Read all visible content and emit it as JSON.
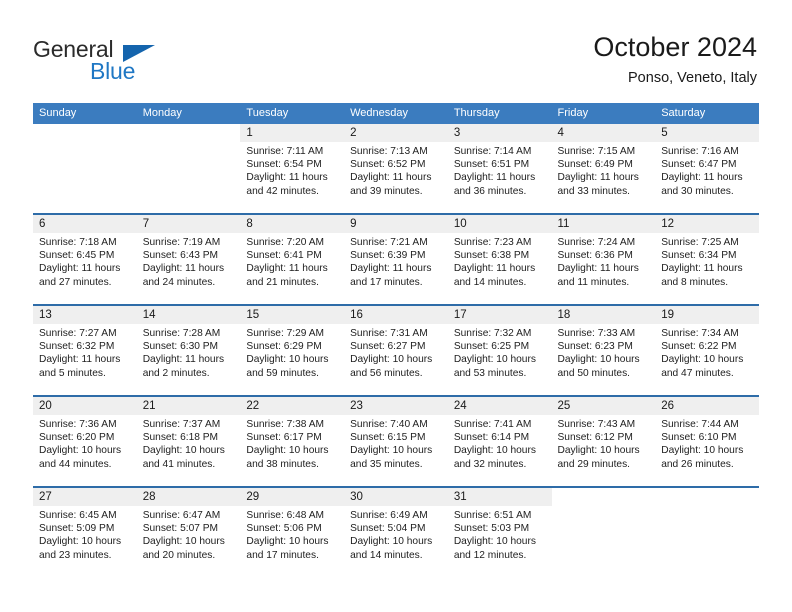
{
  "logo": {
    "text_primary": "General",
    "text_secondary": "Blue",
    "triangle_icon": "blue-triangle-icon",
    "color_primary": "#2b2b2b",
    "color_secondary": "#1f77c4",
    "color_triangle": "#1464ad"
  },
  "header": {
    "title": "October 2024",
    "subtitle": "Ponso, Veneto, Italy"
  },
  "colors": {
    "header_row_bg": "#3b7cbf",
    "week_separator": "#2e6ca8",
    "daynum_band_bg": "#efefef",
    "cell_bg": "#ffffff",
    "text": "#1e1e1e"
  },
  "weekdays": [
    {
      "label": "Sunday"
    },
    {
      "label": "Monday"
    },
    {
      "label": "Tuesday"
    },
    {
      "label": "Wednesday"
    },
    {
      "label": "Thursday"
    },
    {
      "label": "Friday"
    },
    {
      "label": "Saturday"
    }
  ],
  "labels": {
    "sunrise_prefix": "Sunrise:",
    "sunset_prefix": "Sunset:",
    "daylight_prefix": "Daylight:"
  },
  "weeks": [
    {
      "days": [
        {
          "empty": true,
          "daynum": "",
          "sunrise": "",
          "sunset": "",
          "daylight_line1": "",
          "daylight_line2": ""
        },
        {
          "empty": true,
          "daynum": "",
          "sunrise": "",
          "sunset": "",
          "daylight_line1": "",
          "daylight_line2": ""
        },
        {
          "empty": false,
          "daynum": "1",
          "sunrise": "Sunrise: 7:11 AM",
          "sunset": "Sunset: 6:54 PM",
          "daylight_line1": "Daylight: 11 hours",
          "daylight_line2": "and 42 minutes."
        },
        {
          "empty": false,
          "daynum": "2",
          "sunrise": "Sunrise: 7:13 AM",
          "sunset": "Sunset: 6:52 PM",
          "daylight_line1": "Daylight: 11 hours",
          "daylight_line2": "and 39 minutes."
        },
        {
          "empty": false,
          "daynum": "3",
          "sunrise": "Sunrise: 7:14 AM",
          "sunset": "Sunset: 6:51 PM",
          "daylight_line1": "Daylight: 11 hours",
          "daylight_line2": "and 36 minutes."
        },
        {
          "empty": false,
          "daynum": "4",
          "sunrise": "Sunrise: 7:15 AM",
          "sunset": "Sunset: 6:49 PM",
          "daylight_line1": "Daylight: 11 hours",
          "daylight_line2": "and 33 minutes."
        },
        {
          "empty": false,
          "daynum": "5",
          "sunrise": "Sunrise: 7:16 AM",
          "sunset": "Sunset: 6:47 PM",
          "daylight_line1": "Daylight: 11 hours",
          "daylight_line2": "and 30 minutes."
        }
      ]
    },
    {
      "days": [
        {
          "empty": false,
          "daynum": "6",
          "sunrise": "Sunrise: 7:18 AM",
          "sunset": "Sunset: 6:45 PM",
          "daylight_line1": "Daylight: 11 hours",
          "daylight_line2": "and 27 minutes."
        },
        {
          "empty": false,
          "daynum": "7",
          "sunrise": "Sunrise: 7:19 AM",
          "sunset": "Sunset: 6:43 PM",
          "daylight_line1": "Daylight: 11 hours",
          "daylight_line2": "and 24 minutes."
        },
        {
          "empty": false,
          "daynum": "8",
          "sunrise": "Sunrise: 7:20 AM",
          "sunset": "Sunset: 6:41 PM",
          "daylight_line1": "Daylight: 11 hours",
          "daylight_line2": "and 21 minutes."
        },
        {
          "empty": false,
          "daynum": "9",
          "sunrise": "Sunrise: 7:21 AM",
          "sunset": "Sunset: 6:39 PM",
          "daylight_line1": "Daylight: 11 hours",
          "daylight_line2": "and 17 minutes."
        },
        {
          "empty": false,
          "daynum": "10",
          "sunrise": "Sunrise: 7:23 AM",
          "sunset": "Sunset: 6:38 PM",
          "daylight_line1": "Daylight: 11 hours",
          "daylight_line2": "and 14 minutes."
        },
        {
          "empty": false,
          "daynum": "11",
          "sunrise": "Sunrise: 7:24 AM",
          "sunset": "Sunset: 6:36 PM",
          "daylight_line1": "Daylight: 11 hours",
          "daylight_line2": "and 11 minutes."
        },
        {
          "empty": false,
          "daynum": "12",
          "sunrise": "Sunrise: 7:25 AM",
          "sunset": "Sunset: 6:34 PM",
          "daylight_line1": "Daylight: 11 hours",
          "daylight_line2": "and 8 minutes."
        }
      ]
    },
    {
      "days": [
        {
          "empty": false,
          "daynum": "13",
          "sunrise": "Sunrise: 7:27 AM",
          "sunset": "Sunset: 6:32 PM",
          "daylight_line1": "Daylight: 11 hours",
          "daylight_line2": "and 5 minutes."
        },
        {
          "empty": false,
          "daynum": "14",
          "sunrise": "Sunrise: 7:28 AM",
          "sunset": "Sunset: 6:30 PM",
          "daylight_line1": "Daylight: 11 hours",
          "daylight_line2": "and 2 minutes."
        },
        {
          "empty": false,
          "daynum": "15",
          "sunrise": "Sunrise: 7:29 AM",
          "sunset": "Sunset: 6:29 PM",
          "daylight_line1": "Daylight: 10 hours",
          "daylight_line2": "and 59 minutes."
        },
        {
          "empty": false,
          "daynum": "16",
          "sunrise": "Sunrise: 7:31 AM",
          "sunset": "Sunset: 6:27 PM",
          "daylight_line1": "Daylight: 10 hours",
          "daylight_line2": "and 56 minutes."
        },
        {
          "empty": false,
          "daynum": "17",
          "sunrise": "Sunrise: 7:32 AM",
          "sunset": "Sunset: 6:25 PM",
          "daylight_line1": "Daylight: 10 hours",
          "daylight_line2": "and 53 minutes."
        },
        {
          "empty": false,
          "daynum": "18",
          "sunrise": "Sunrise: 7:33 AM",
          "sunset": "Sunset: 6:23 PM",
          "daylight_line1": "Daylight: 10 hours",
          "daylight_line2": "and 50 minutes."
        },
        {
          "empty": false,
          "daynum": "19",
          "sunrise": "Sunrise: 7:34 AM",
          "sunset": "Sunset: 6:22 PM",
          "daylight_line1": "Daylight: 10 hours",
          "daylight_line2": "and 47 minutes."
        }
      ]
    },
    {
      "days": [
        {
          "empty": false,
          "daynum": "20",
          "sunrise": "Sunrise: 7:36 AM",
          "sunset": "Sunset: 6:20 PM",
          "daylight_line1": "Daylight: 10 hours",
          "daylight_line2": "and 44 minutes."
        },
        {
          "empty": false,
          "daynum": "21",
          "sunrise": "Sunrise: 7:37 AM",
          "sunset": "Sunset: 6:18 PM",
          "daylight_line1": "Daylight: 10 hours",
          "daylight_line2": "and 41 minutes."
        },
        {
          "empty": false,
          "daynum": "22",
          "sunrise": "Sunrise: 7:38 AM",
          "sunset": "Sunset: 6:17 PM",
          "daylight_line1": "Daylight: 10 hours",
          "daylight_line2": "and 38 minutes."
        },
        {
          "empty": false,
          "daynum": "23",
          "sunrise": "Sunrise: 7:40 AM",
          "sunset": "Sunset: 6:15 PM",
          "daylight_line1": "Daylight: 10 hours",
          "daylight_line2": "and 35 minutes."
        },
        {
          "empty": false,
          "daynum": "24",
          "sunrise": "Sunrise: 7:41 AM",
          "sunset": "Sunset: 6:14 PM",
          "daylight_line1": "Daylight: 10 hours",
          "daylight_line2": "and 32 minutes."
        },
        {
          "empty": false,
          "daynum": "25",
          "sunrise": "Sunrise: 7:43 AM",
          "sunset": "Sunset: 6:12 PM",
          "daylight_line1": "Daylight: 10 hours",
          "daylight_line2": "and 29 minutes."
        },
        {
          "empty": false,
          "daynum": "26",
          "sunrise": "Sunrise: 7:44 AM",
          "sunset": "Sunset: 6:10 PM",
          "daylight_line1": "Daylight: 10 hours",
          "daylight_line2": "and 26 minutes."
        }
      ]
    },
    {
      "days": [
        {
          "empty": false,
          "daynum": "27",
          "sunrise": "Sunrise: 6:45 AM",
          "sunset": "Sunset: 5:09 PM",
          "daylight_line1": "Daylight: 10 hours",
          "daylight_line2": "and 23 minutes."
        },
        {
          "empty": false,
          "daynum": "28",
          "sunrise": "Sunrise: 6:47 AM",
          "sunset": "Sunset: 5:07 PM",
          "daylight_line1": "Daylight: 10 hours",
          "daylight_line2": "and 20 minutes."
        },
        {
          "empty": false,
          "daynum": "29",
          "sunrise": "Sunrise: 6:48 AM",
          "sunset": "Sunset: 5:06 PM",
          "daylight_line1": "Daylight: 10 hours",
          "daylight_line2": "and 17 minutes."
        },
        {
          "empty": false,
          "daynum": "30",
          "sunrise": "Sunrise: 6:49 AM",
          "sunset": "Sunset: 5:04 PM",
          "daylight_line1": "Daylight: 10 hours",
          "daylight_line2": "and 14 minutes."
        },
        {
          "empty": false,
          "daynum": "31",
          "sunrise": "Sunrise: 6:51 AM",
          "sunset": "Sunset: 5:03 PM",
          "daylight_line1": "Daylight: 10 hours",
          "daylight_line2": "and 12 minutes."
        },
        {
          "empty": true,
          "daynum": "",
          "sunrise": "",
          "sunset": "",
          "daylight_line1": "",
          "daylight_line2": ""
        },
        {
          "empty": true,
          "daynum": "",
          "sunrise": "",
          "sunset": "",
          "daylight_line1": "",
          "daylight_line2": ""
        }
      ]
    }
  ]
}
